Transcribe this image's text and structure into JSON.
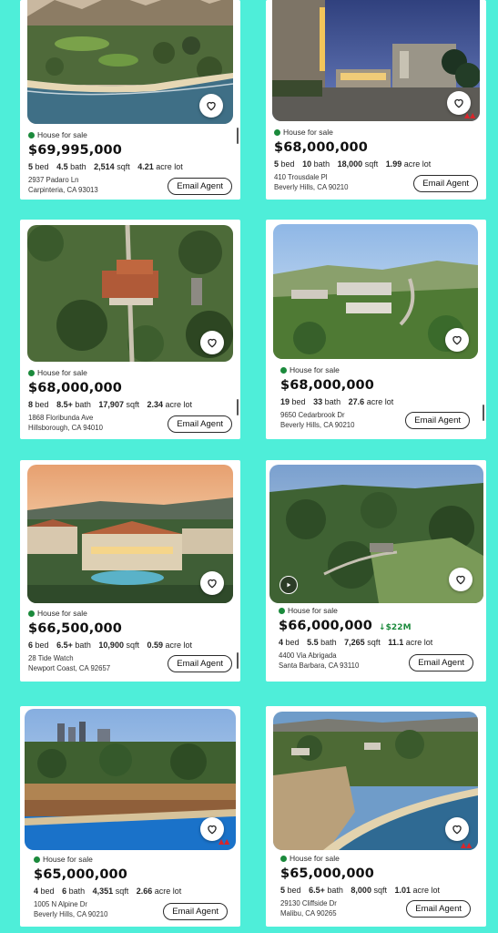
{
  "accent_bg": "#4eeed9",
  "status_color": "#1b8a3c",
  "listings": [
    {
      "status": "House for sale",
      "price": "$69,995,000",
      "price_drop": "",
      "beds": "5",
      "bed_label": "bed",
      "baths": "4.5",
      "bath_label": "bath",
      "sqft": "2,514",
      "sqft_label": "sqft",
      "lot": "4.21",
      "lot_label": "acre lot",
      "street": "2937 Padaro Ln",
      "city": "Carpinteria, CA 93013",
      "email_label": "Email Agent",
      "favorite_icon": "heart-outline-icon"
    },
    {
      "status": "House for sale",
      "price": "$68,000,000",
      "price_drop": "",
      "beds": "5",
      "bed_label": "bed",
      "baths": "10",
      "bath_label": "bath",
      "sqft": "18,000",
      "sqft_label": "sqft",
      "lot": "1.99",
      "lot_label": "acre lot",
      "street": "410 Trousdale Pl",
      "city": "Beverly Hills, CA 90210",
      "email_label": "Email Agent",
      "favorite_icon": "heart-outline-icon"
    },
    {
      "status": "House for sale",
      "price": "$68,000,000",
      "price_drop": "",
      "beds": "8",
      "bed_label": "bed",
      "baths": "8.5+",
      "bath_label": "bath",
      "sqft": "17,907",
      "sqft_label": "sqft",
      "lot": "2.34",
      "lot_label": "acre lot",
      "street": "1868 Floribunda Ave",
      "city": "Hillsborough, CA 94010",
      "email_label": "Email Agent",
      "favorite_icon": "heart-outline-icon"
    },
    {
      "status": "House for sale",
      "price": "$68,000,000",
      "price_drop": "",
      "beds": "19",
      "bed_label": "bed",
      "baths": "33",
      "bath_label": "bath",
      "sqft": "",
      "sqft_label": "",
      "lot": "27.6",
      "lot_label": "acre lot",
      "street": "9650 Cedarbrook Dr",
      "city": "Beverly Hills, CA 90210",
      "email_label": "Email Agent",
      "favorite_icon": "heart-outline-icon"
    },
    {
      "status": "House for sale",
      "price": "$66,500,000",
      "price_drop": "",
      "beds": "6",
      "bed_label": "bed",
      "baths": "6.5+",
      "bath_label": "bath",
      "sqft": "10,900",
      "sqft_label": "sqft",
      "lot": "0.59",
      "lot_label": "acre lot",
      "street": "28 Tide Watch",
      "city": "Newport Coast, CA 92657",
      "email_label": "Email Agent",
      "favorite_icon": "heart-outline-icon"
    },
    {
      "status": "House for sale",
      "price": "$66,000,000",
      "price_drop": "↓$22M",
      "beds": "4",
      "bed_label": "bed",
      "baths": "5.5",
      "bath_label": "bath",
      "sqft": "7,265",
      "sqft_label": "sqft",
      "lot": "11.1",
      "lot_label": "acre lot",
      "street": "4400 Via Abrigada",
      "city": "Santa Barbara, CA 93110",
      "email_label": "Email Agent",
      "favorite_icon": "heart-outline-icon"
    },
    {
      "status": "House for sale",
      "price": "$65,000,000",
      "price_drop": "",
      "beds": "4",
      "bed_label": "bed",
      "baths": "6",
      "bath_label": "bath",
      "sqft": "4,351",
      "sqft_label": "sqft",
      "lot": "2.66",
      "lot_label": "acre lot",
      "street": "1005 N Alpine Dr",
      "city": "Beverly Hills, CA 90210",
      "email_label": "Email Agent",
      "favorite_icon": "heart-outline-icon"
    },
    {
      "status": "House for sale",
      "price": "$65,000,000",
      "price_drop": "",
      "beds": "5",
      "bed_label": "bed",
      "baths": "6.5+",
      "bath_label": "bath",
      "sqft": "8,000",
      "sqft_label": "sqft",
      "lot": "1.01",
      "lot_label": "acre lot",
      "street": "29130 Cliffside Dr",
      "city": "Malibu, CA 90265",
      "email_label": "Email Agent",
      "favorite_icon": "heart-outline-icon"
    }
  ]
}
